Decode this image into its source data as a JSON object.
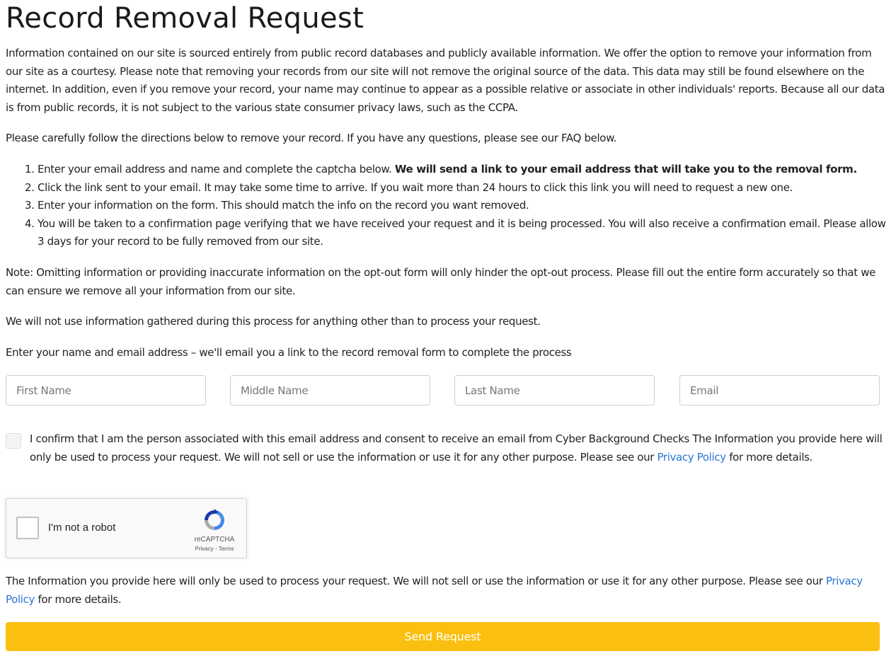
{
  "page": {
    "title": "Record Removal Request",
    "intro": "Information contained on our site is sourced entirely from public record databases and publicly available information. We offer the option to remove your information from our site as a courtesy. Please note that removing your records from our site will not remove the original source of the data. This data may still be found elsewhere on the internet. In addition, even if you remove your record, your name may continue to appear as a possible relative or associate in other individuals' reports. Because all our data is from public records, it is not subject to the various state consumer privacy laws, such as the CCPA.",
    "directions": "Please carefully follow the directions below to remove your record. If you have any questions, please see our FAQ below.",
    "steps": [
      {
        "text": "Enter your email address and name and complete the captcha below. ",
        "bold": "We will send a link to your email address that will take you to the removal form."
      },
      {
        "text": "Click the link sent to your email. It may take some time to arrive. If you wait more than 24 hours to click this link you will need to request a new one."
      },
      {
        "text": "Enter your information on the form. This should match the info on the record you want removed."
      },
      {
        "text": "You will be taken to a confirmation page verifying that we have received your request and it is being processed. You will also receive a confirmation email. Please allow 3 days for your record to be fully removed from our site."
      }
    ],
    "note": "Note: Omitting information or providing inaccurate information on the opt-out form will only hinder the opt-out process. Please fill out the entire form accurately so that we can ensure we remove all your information from our site.",
    "no_use": "We will not use information gathered during this process for anything other than to process your request.",
    "enter_prompt": "Enter your name and email address – we'll email you a link to the record removal form to complete the process"
  },
  "form": {
    "first_name": {
      "value": "",
      "placeholder": "First Name"
    },
    "middle_name": {
      "value": "",
      "placeholder": "Middle Name"
    },
    "last_name": {
      "value": "",
      "placeholder": "Last Name"
    },
    "email": {
      "value": "",
      "placeholder": "Email"
    },
    "consent": {
      "checked": false,
      "text": "I confirm that I am the person associated with this email address and consent to receive an email from Cyber Background Checks The Information you provide here will only be used to process your request. We will not sell or use the information or use it for any other purpose. Please see our ",
      "link": "Privacy Policy",
      "after": " for more details."
    },
    "recaptcha": {
      "label": "I'm not a robot",
      "brand": "reCAPTCHA",
      "terms": "Privacy - Terms",
      "icon": "recaptcha-logo-icon"
    },
    "footer": {
      "text": "The Information you provide here will only be used to process your request. We will not sell or use the information or use it for any other purpose. Please see our ",
      "link": "Privacy Policy",
      "after": " for more details."
    },
    "submit_label": "Send Request"
  },
  "colors": {
    "accent": "#fbbf0f",
    "link": "#2a75d3",
    "text": "#222222"
  }
}
